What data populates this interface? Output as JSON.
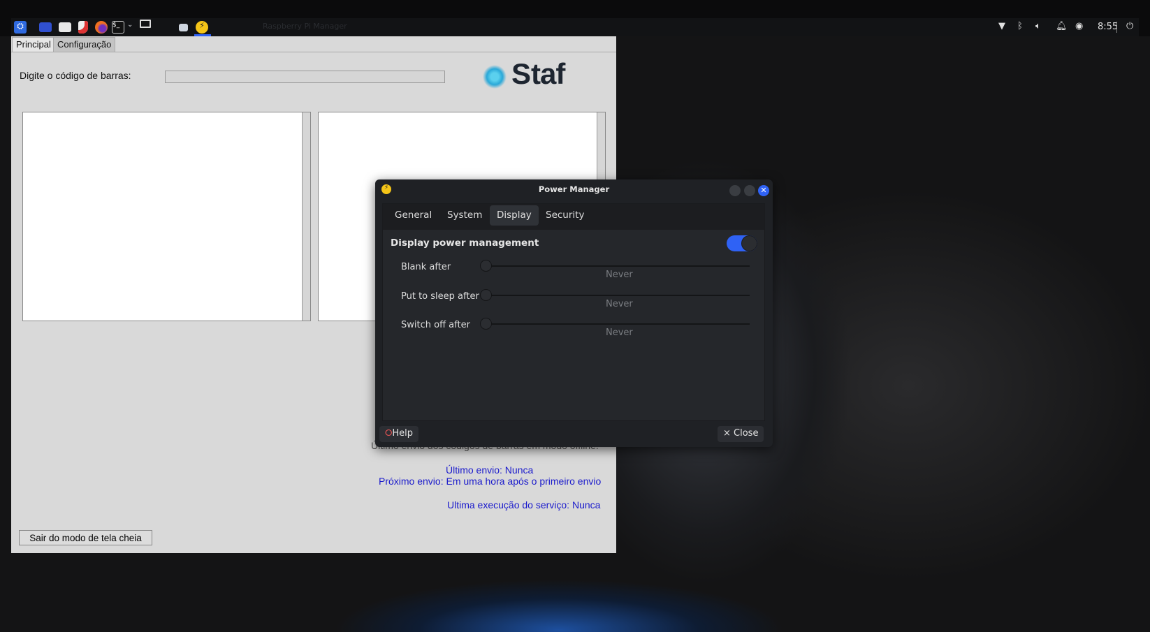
{
  "taskbar": {
    "window_title": "Raspberry Pi Manager",
    "clock": "8:55",
    "launchers": [
      "kali-menu-icon",
      "desktop-icon",
      "file-manager-icon",
      "text-editor-icon",
      "firefox-icon",
      "terminal-icon",
      "workspace-icon"
    ],
    "tray": [
      "wifi-icon",
      "bluetooth-icon",
      "volume-icon",
      "notification-icon",
      "power-icon",
      "logout-icon"
    ]
  },
  "app": {
    "tabs": [
      "Principal",
      "Configuração"
    ],
    "barcode_label": "Digite o código de barras:",
    "barcode_value": "",
    "logo_text": "Staf",
    "offline_label": "Último envio dos códigos de barras em modo offline:",
    "last_send": "Último envio: Nunca",
    "next_send": "Próximo envio: Em uma hora após o primeiro envio",
    "last_run": "Ultima execução do serviço: Nunca",
    "exit_fullscreen": "Sair do modo de tela cheia"
  },
  "dialog": {
    "title": "Power Manager",
    "tabs": [
      "General",
      "System",
      "Display",
      "Security"
    ],
    "active_tab": "Display",
    "dpm_label": "Display power management",
    "dpm_enabled": true,
    "rows": [
      {
        "label": "Blank after",
        "value": "Never"
      },
      {
        "label": "Put to sleep after",
        "value": "Never"
      },
      {
        "label": "Switch off after",
        "value": "Never"
      }
    ],
    "help": "Help",
    "close": "Close"
  },
  "colors": {
    "accent": "#2f62f5",
    "link_blue": "#1a1acc"
  }
}
